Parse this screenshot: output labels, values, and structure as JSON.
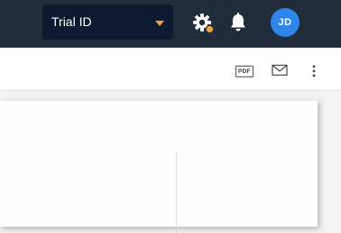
{
  "header": {
    "trial_select": {
      "value": "Trial ID"
    },
    "settings_icon": "gear-icon",
    "notifications_icon": "bell-icon",
    "user": {
      "initials": "JD"
    }
  },
  "toolbar": {
    "pdf_label": "PDF",
    "email_icon": "envelope-icon",
    "more_icon": "kebab-menu-icon"
  },
  "colors": {
    "topbar": "#212c3d",
    "select_bg": "#0d1a30",
    "accent_caret": "#f5a236",
    "avatar": "#2e87e8"
  }
}
